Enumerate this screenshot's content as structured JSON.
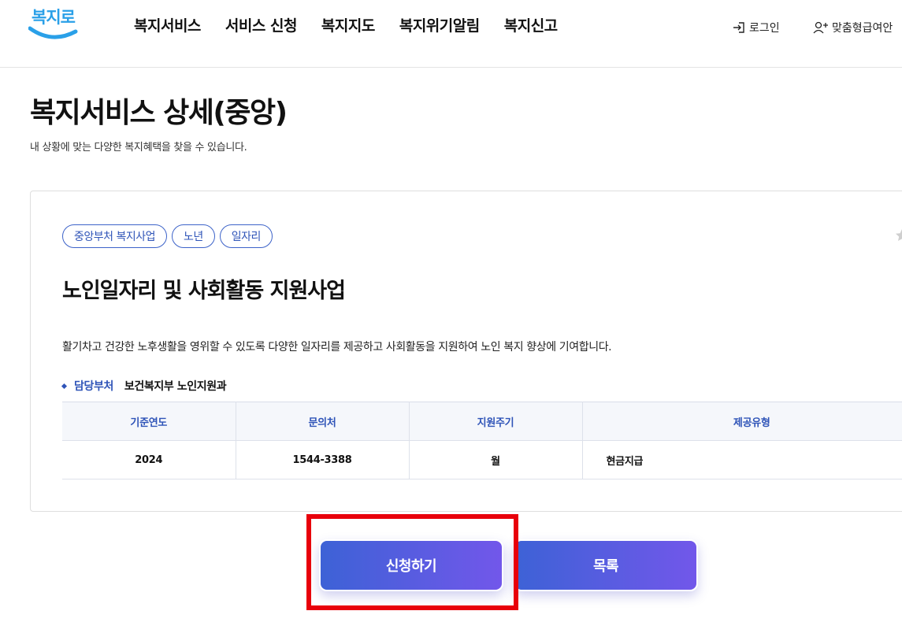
{
  "header": {
    "logo_text": "복지로",
    "nav": [
      "복지서비스",
      "서비스 신청",
      "복지지도",
      "복지위기알림",
      "복지신고"
    ],
    "login_label": "로그인",
    "custom_label": "맞춤형급여안"
  },
  "page": {
    "title": "복지서비스 상세(중앙)",
    "subtitle": "내 상황에 맞는 다양한 복지혜택을 찾을 수 있습니다."
  },
  "service": {
    "tags": [
      "중앙부처 복지사업",
      "노년",
      "일자리"
    ],
    "title": "노인일자리 및 사회활동 지원사업",
    "description": "활기차고 건강한 노후생활을 영위할 수 있도록 다양한 일자리를 제공하고 사회활동을 지원하여 노인 복지 향상에 기여합니다.",
    "dept_label": "담당부처",
    "dept_value": "보건복지부 노인지원과",
    "table": {
      "headers": [
        "기준연도",
        "문의처",
        "지원주기",
        "제공유형"
      ],
      "row": [
        "2024",
        "1544-3388",
        "월",
        "현금지급"
      ]
    }
  },
  "buttons": {
    "apply_label": "신청하기",
    "list_label": "목록"
  },
  "colors": {
    "accent": "#2f54b8",
    "button_gradient_start": "#3d62d6",
    "button_gradient_end": "#7257ea",
    "highlight": "#e8000b",
    "logo": "#2aa0e8"
  }
}
